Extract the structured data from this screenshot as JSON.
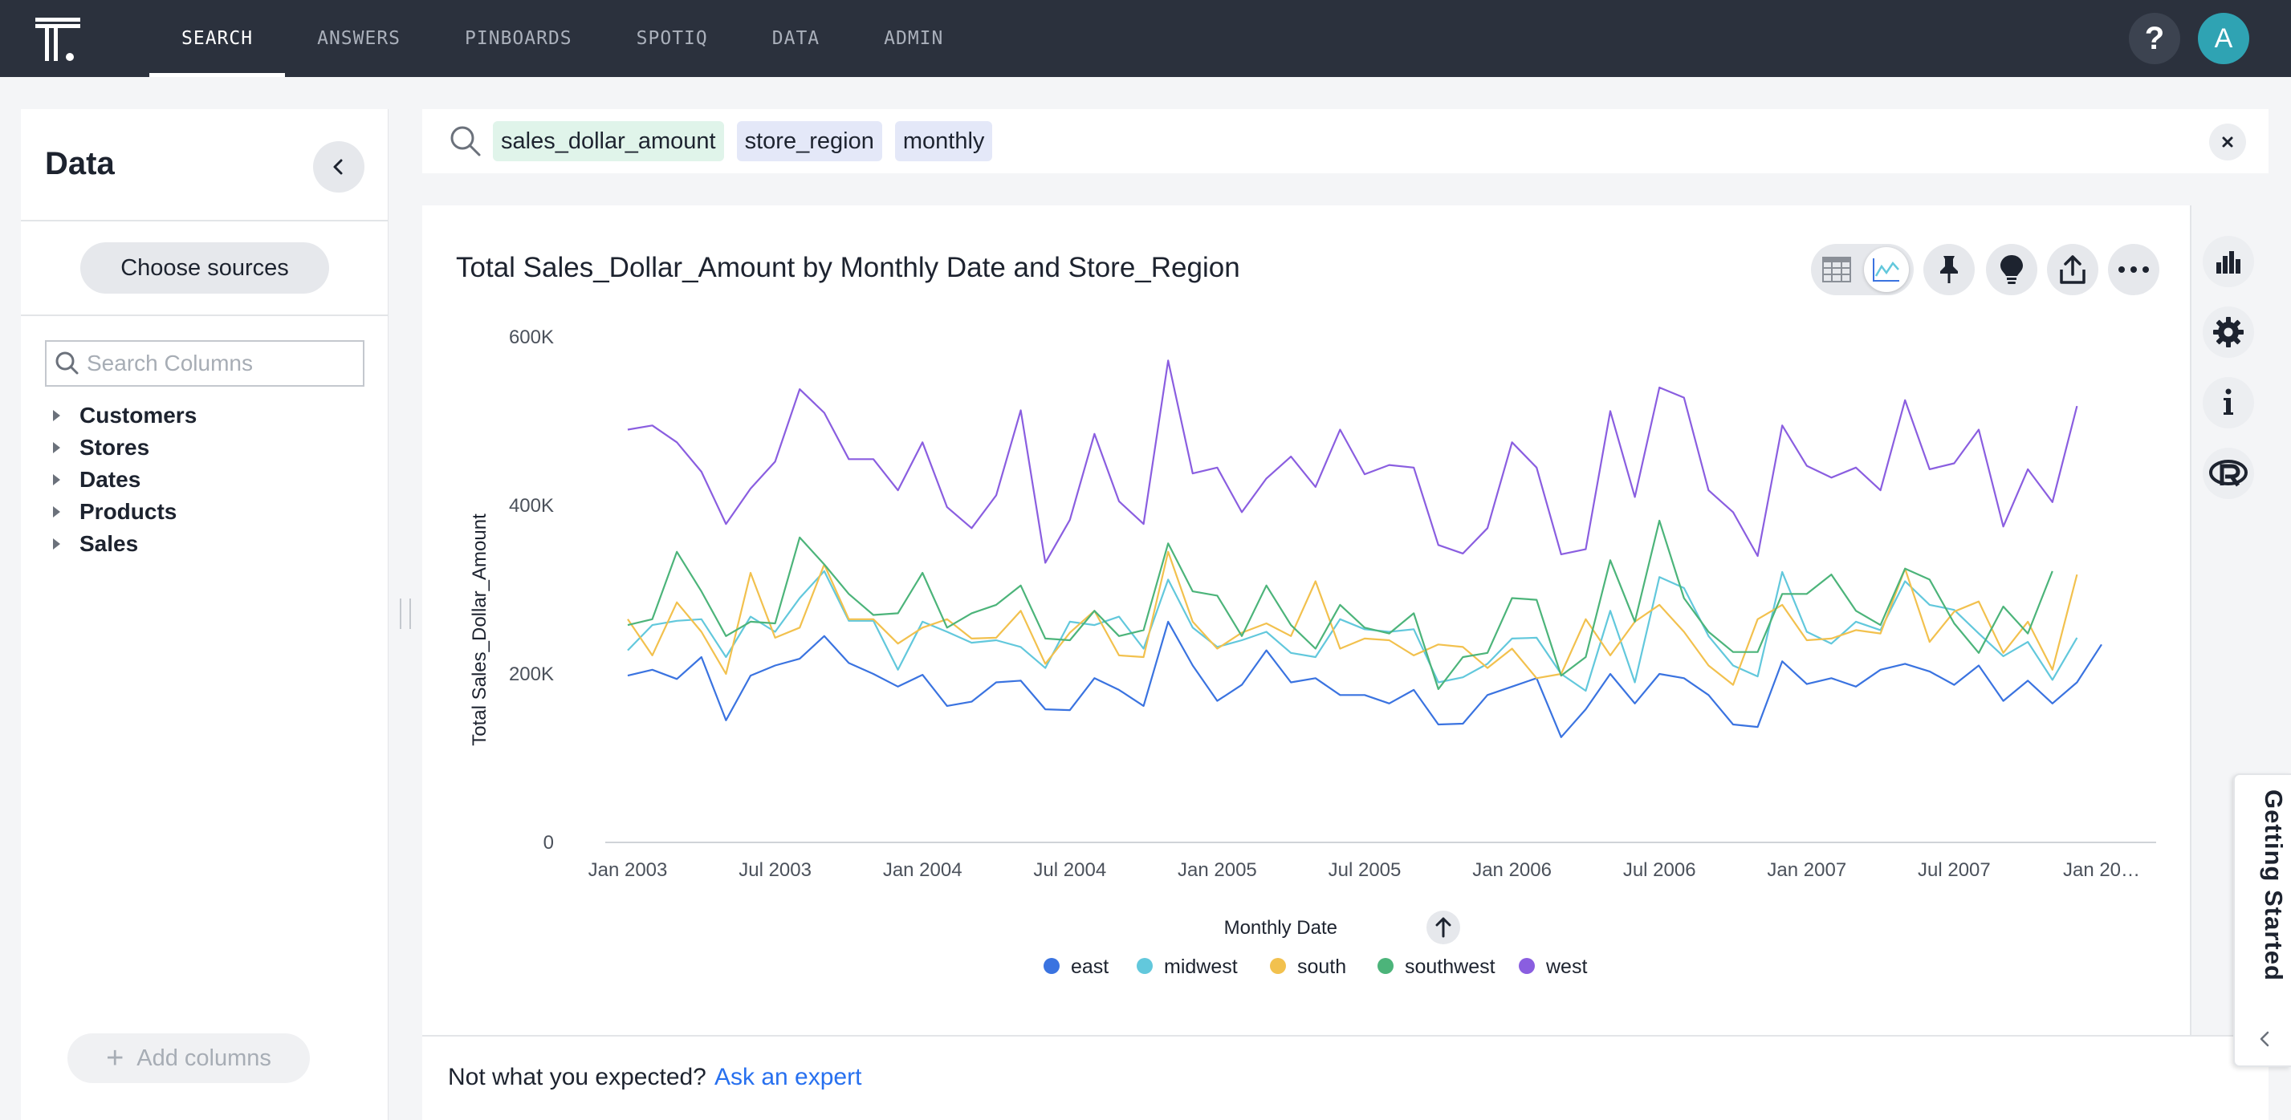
{
  "nav": {
    "items": [
      "SEARCH",
      "ANSWERS",
      "PINBOARDS",
      "SPOTIQ",
      "DATA",
      "ADMIN"
    ],
    "active": "SEARCH",
    "help_label": "?",
    "avatar_initial": "A"
  },
  "data_panel": {
    "title": "Data",
    "choose_sources_label": "Choose sources",
    "search_placeholder": "Search Columns",
    "tree": [
      "Customers",
      "Stores",
      "Dates",
      "Products",
      "Sales"
    ],
    "add_columns_label": "Add columns"
  },
  "search": {
    "tokens": [
      {
        "text": "sales_dollar_amount",
        "kind": "measure"
      },
      {
        "text": "store_region",
        "kind": "attribute"
      },
      {
        "text": "monthly",
        "kind": "attribute"
      }
    ]
  },
  "chart_header": {
    "title": "Total Sales_Dollar_Amount by Monthly Date and Store_Region"
  },
  "footer": {
    "prompt": "Not what you expected?",
    "link": "Ask an expert"
  },
  "getting_started": "Getting Started",
  "icons": {
    "toolbar": [
      "table-icon",
      "line-chart-icon",
      "pin-icon",
      "lightbulb-icon",
      "share-icon",
      "more-icon"
    ],
    "rail": [
      "bar-chart-icon",
      "gear-icon",
      "info-icon",
      "r-analysis-icon"
    ]
  },
  "colors": {
    "nav_bg": "#2b313d",
    "accent_link": "#2770ef",
    "east": "#3a73e0",
    "midwest": "#62c8dc",
    "south": "#f2c14e",
    "southwest": "#4cb47a",
    "west": "#8a5ee0"
  },
  "chart_data": {
    "type": "line",
    "title": "Total Sales_Dollar_Amount by Monthly Date and Store_Region",
    "xlabel": "Monthly Date",
    "ylabel": "Total Sales_Dollar_Amount",
    "sort_indicator": "ascending",
    "ylim": [
      0,
      600000
    ],
    "y_ticks": [
      "0",
      "200K",
      "400K",
      "600K"
    ],
    "x_ticks": [
      "Jan 2003",
      "Jul 2003",
      "Jan 2004",
      "Jul 2004",
      "Jan 2005",
      "Jul 2005",
      "Jan 2006",
      "Jul 2006",
      "Jan 2007",
      "Jul 2007",
      "Jan 20…"
    ],
    "grid": false,
    "legend_position": "bottom",
    "x": [
      "2003-01",
      "2003-02",
      "2003-03",
      "2003-04",
      "2003-05",
      "2003-06",
      "2003-07",
      "2003-08",
      "2003-09",
      "2003-10",
      "2003-11",
      "2003-12",
      "2004-01",
      "2004-02",
      "2004-03",
      "2004-04",
      "2004-05",
      "2004-06",
      "2004-07",
      "2004-08",
      "2004-09",
      "2004-10",
      "2004-11",
      "2004-12",
      "2005-01",
      "2005-02",
      "2005-03",
      "2005-04",
      "2005-05",
      "2005-06",
      "2005-07",
      "2005-08",
      "2005-09",
      "2005-10",
      "2005-11",
      "2005-12",
      "2006-01",
      "2006-02",
      "2006-03",
      "2006-04",
      "2006-05",
      "2006-06",
      "2006-07",
      "2006-08",
      "2006-09",
      "2006-10",
      "2006-11",
      "2006-12",
      "2007-01",
      "2007-02",
      "2007-03",
      "2007-04",
      "2007-05",
      "2007-06",
      "2007-07",
      "2007-08",
      "2007-09",
      "2007-10",
      "2007-11",
      "2007-12",
      "2008-01"
    ],
    "series": [
      {
        "name": "east",
        "color": "#3a73e0",
        "values": [
          198000,
          205000,
          194000,
          220000,
          145000,
          198000,
          210000,
          218000,
          245000,
          213000,
          200000,
          185000,
          199000,
          162000,
          167000,
          190000,
          192000,
          158000,
          157000,
          195000,
          181000,
          162000,
          262000,
          210000,
          168000,
          187000,
          228000,
          190000,
          195000,
          175000,
          175000,
          165000,
          181000,
          140000,
          141000,
          175000,
          185000,
          195000,
          125000,
          158000,
          200000,
          165000,
          200000,
          195000,
          175000,
          140000,
          137000,
          215000,
          188000,
          195000,
          185000,
          205000,
          212000,
          203000,
          187000,
          210000,
          168000,
          192000,
          165000,
          190000,
          235000
        ]
      },
      {
        "name": "midwest",
        "color": "#62c8dc",
        "values": [
          228000,
          258000,
          263000,
          265000,
          220000,
          268000,
          250000,
          290000,
          322000,
          263000,
          263000,
          205000,
          262000,
          250000,
          237000,
          240000,
          232000,
          207000,
          262000,
          258000,
          268000,
          230000,
          312000,
          255000,
          232000,
          240000,
          250000,
          225000,
          220000,
          265000,
          253000,
          250000,
          253000,
          190000,
          196000,
          212000,
          242000,
          243000,
          200000,
          180000,
          275000,
          190000,
          315000,
          302000,
          245000,
          210000,
          197000,
          321000,
          250000,
          236000,
          262000,
          252000,
          310000,
          282000,
          276000,
          248000,
          221000,
          238000,
          193000,
          243000
        ]
      },
      {
        "name": "south",
        "color": "#f2c14e",
        "values": [
          265000,
          222000,
          285000,
          250000,
          200000,
          320000,
          243000,
          255000,
          330000,
          265000,
          265000,
          236000,
          255000,
          265000,
          242000,
          243000,
          275000,
          212000,
          249000,
          275000,
          222000,
          220000,
          345000,
          262000,
          230000,
          249000,
          260000,
          245000,
          310000,
          230000,
          242000,
          240000,
          222000,
          235000,
          232000,
          207000,
          230000,
          195000,
          200000,
          265000,
          222000,
          262000,
          282000,
          250000,
          210000,
          187000,
          265000,
          282000,
          240000,
          242000,
          252000,
          248000,
          325000,
          238000,
          274000,
          286000,
          225000,
          262000,
          205000,
          318000
        ]
      },
      {
        "name": "southwest",
        "color": "#4cb47a",
        "values": [
          258000,
          265000,
          345000,
          298000,
          245000,
          262000,
          260000,
          362000,
          330000,
          295000,
          270000,
          272000,
          320000,
          255000,
          272000,
          282000,
          305000,
          242000,
          240000,
          275000,
          245000,
          252000,
          355000,
          298000,
          293000,
          245000,
          305000,
          258000,
          230000,
          282000,
          255000,
          248000,
          272000,
          182000,
          220000,
          225000,
          290000,
          288000,
          198000,
          220000,
          335000,
          262000,
          382000,
          290000,
          250000,
          226000,
          226000,
          295000,
          295000,
          318000,
          275000,
          258000,
          325000,
          312000,
          260000,
          225000,
          280000,
          248000,
          322000
        ]
      },
      {
        "name": "west",
        "color": "#8a5ee0",
        "values": [
          490000,
          495000,
          475000,
          440000,
          378000,
          420000,
          452000,
          538000,
          510000,
          455000,
          455000,
          418000,
          475000,
          398000,
          373000,
          412000,
          513000,
          332000,
          383000,
          485000,
          405000,
          378000,
          572000,
          438000,
          445000,
          392000,
          432000,
          458000,
          422000,
          490000,
          437000,
          448000,
          445000,
          353000,
          343000,
          373000,
          475000,
          445000,
          342000,
          348000,
          512000,
          410000,
          540000,
          528000,
          418000,
          392000,
          340000,
          495000,
          447000,
          433000,
          445000,
          418000,
          525000,
          443000,
          450000,
          490000,
          375000,
          443000,
          404000,
          518000
        ]
      }
    ]
  }
}
